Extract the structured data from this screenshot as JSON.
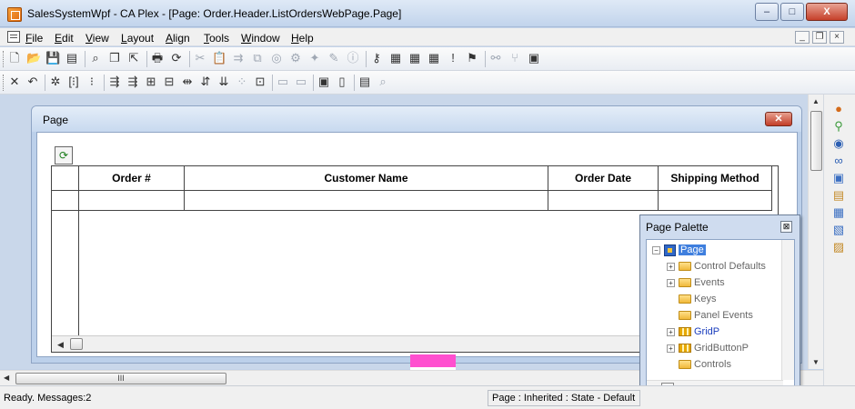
{
  "window": {
    "title": "SalesSystemWpf - CA Plex - [Page: Order.Header.ListOrdersWebPage.Page]",
    "minimize_glyph": "–",
    "maximize_glyph": "□",
    "close_glyph": "X"
  },
  "menubar": {
    "items": [
      {
        "label": "File",
        "key": "F",
        "rest": "ile"
      },
      {
        "label": "Edit",
        "key": "E",
        "rest": "dit"
      },
      {
        "label": "View",
        "key": "V",
        "rest": "iew"
      },
      {
        "label": "Layout",
        "key": "L",
        "rest": "ayout"
      },
      {
        "label": "Align",
        "key": "A",
        "rest": "lign"
      },
      {
        "label": "Tools",
        "key": "T",
        "rest": "ools"
      },
      {
        "label": "Window",
        "key": "W",
        "rest": "indow"
      },
      {
        "label": "Help",
        "key": "H",
        "rest": "elp"
      }
    ],
    "mdi_min": "_",
    "mdi_restore": "❐",
    "mdi_close": "×"
  },
  "toolbar1": {
    "icons": [
      "new-icon",
      "open-icon",
      "save-icon",
      "save-all-icon",
      "find-icon",
      "properties-icon",
      "pointer-icon",
      "print-icon",
      "refresh-icon",
      "cut-icon",
      "paste-icon",
      "insert-icon",
      "link-icon",
      "ring-icon",
      "gear-icon",
      "wand-icon",
      "edit-icon",
      "info-icon",
      "key-icon",
      "panel-a-icon",
      "panel-b-icon",
      "panel-c-icon",
      "alert-icon",
      "flag-icon",
      "connect-icon",
      "tree-icon",
      "window-icon"
    ],
    "glyphs": [
      "🗋",
      "📂",
      "💾",
      "▤",
      "⌕",
      "❐",
      "⇱",
      "🖶",
      "⟳",
      "✂",
      "📋",
      "⇉",
      "⧉",
      "◎",
      "⚙",
      "✦",
      "✎",
      "ⓘ",
      "⚷",
      "▦",
      "▦",
      "▦",
      "!",
      "⚑",
      "⚯",
      "⑂",
      "▣"
    ]
  },
  "toolbar2": {
    "icons": [
      "delete-icon",
      "undo-icon",
      "snap-icon",
      "align-left-icon",
      "align-grid-icon",
      "distribute-icon",
      "distribute-2-icon",
      "space-h-icon",
      "space-v-icon",
      "size-h-icon",
      "size-v-icon",
      "order-icon",
      "grid-dots-icon",
      "center-icon",
      "tab-a-icon",
      "tab-b-icon",
      "props-icon",
      "panel-icon",
      "preview-icon",
      "zoom-icon"
    ],
    "glyphs": [
      "✕",
      "↶",
      "✲",
      "[⁝]",
      "⁝",
      "⇶",
      "⇶",
      "⊞",
      "⊟",
      "⇹",
      "⇵",
      "⇊",
      "⁘",
      "⊡",
      "▭",
      "▭",
      "▣",
      "▯",
      "▤",
      "⌕"
    ]
  },
  "page_window": {
    "title": "Page",
    "close_glyph": "✕",
    "refresh_glyph": "⟳",
    "grid": {
      "columns": [
        "Order #",
        "Customer Name",
        "Order Date",
        "Shipping Method"
      ],
      "scroll_left_glyph": "◀"
    }
  },
  "palette": {
    "title": "Page Palette",
    "close_glyph": "⊠",
    "tree": {
      "root": "Page",
      "items": [
        {
          "label": "Control Defaults",
          "expandable": true,
          "icon": "folder"
        },
        {
          "label": "Events",
          "expandable": true,
          "icon": "folder"
        },
        {
          "label": "Keys",
          "expandable": false,
          "icon": "folder"
        },
        {
          "label": "Panel Events",
          "expandable": false,
          "icon": "folder"
        },
        {
          "label": "GridP",
          "expandable": true,
          "icon": "grid",
          "link": true
        },
        {
          "label": "GridButtonP",
          "expandable": true,
          "icon": "grid"
        },
        {
          "label": "Controls",
          "expandable": false,
          "icon": "folder"
        }
      ]
    }
  },
  "side_toolbar": {
    "icons": [
      "sphere-icon",
      "connector-icon",
      "globe-icon",
      "link-icon",
      "panel-icon",
      "panel-edit-icon",
      "panel-grid-icon",
      "panel-props-icon",
      "key-panel-icon"
    ],
    "glyphs": [
      "●",
      "⚲",
      "◉",
      "∞",
      "▣",
      "▤",
      "▦",
      "▧",
      "▨"
    ],
    "colors": [
      "#d46b1a",
      "#3a9a3a",
      "#2c5fb3",
      "#2c5fb3",
      "#3b6fc2",
      "#c48b2a",
      "#3b6fc2",
      "#3b6fc2",
      "#c48b2a"
    ]
  },
  "hscroll": {
    "thumb_glyph": "III",
    "left_glyph": "◀"
  },
  "vscroll": {
    "up_glyph": "▲",
    "down_glyph": "▼"
  },
  "statusbar": {
    "left": "Ready.  Messages:2",
    "middle": "Page : Inherited : State - Default"
  }
}
